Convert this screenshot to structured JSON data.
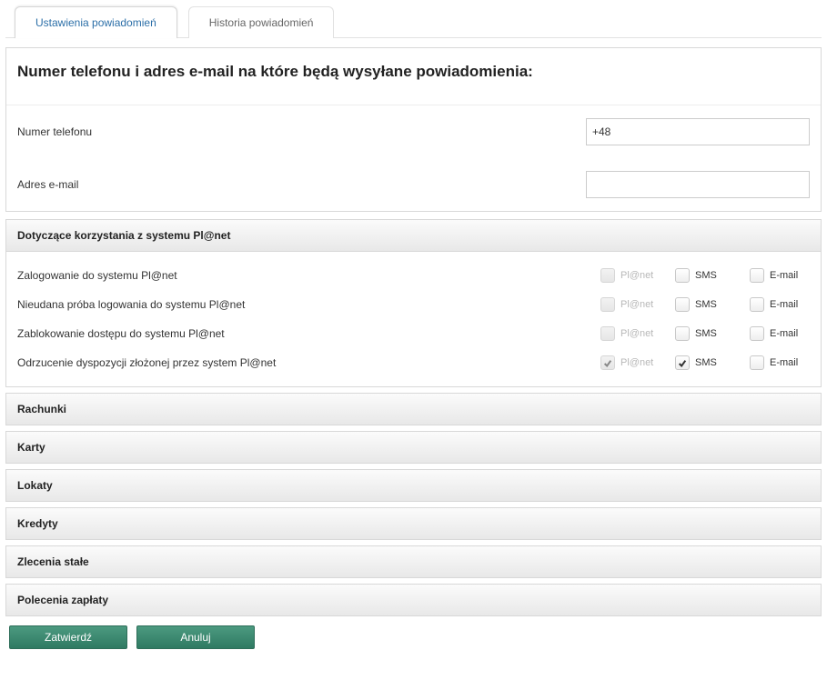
{
  "tabs": {
    "settings": "Ustawienia powiadomień",
    "history": "Historia powiadomień"
  },
  "contact": {
    "title": "Numer telefonu i adres e-mail na które będą wysyłane powiadomienia:",
    "phone_label": "Numer telefonu",
    "phone_value": "+48",
    "email_label": "Adres e-mail",
    "email_value": ""
  },
  "channels": {
    "planet": "Pl@net",
    "sms": "SMS",
    "email": "E-mail"
  },
  "system_section_title": "Dotyczące korzystania z systemu Pl@net",
  "system_rows": [
    {
      "label": "Zalogowanie do systemu Pl@net",
      "planet": {
        "checked": false,
        "enabled": false
      },
      "sms": {
        "checked": false,
        "enabled": true
      },
      "email": {
        "checked": false,
        "enabled": true
      }
    },
    {
      "label": "Nieudana próba logowania do systemu Pl@net",
      "planet": {
        "checked": false,
        "enabled": false
      },
      "sms": {
        "checked": false,
        "enabled": true
      },
      "email": {
        "checked": false,
        "enabled": true
      }
    },
    {
      "label": "Zablokowanie dostępu do systemu Pl@net",
      "planet": {
        "checked": false,
        "enabled": false
      },
      "sms": {
        "checked": false,
        "enabled": true
      },
      "email": {
        "checked": false,
        "enabled": true
      }
    },
    {
      "label": "Odrzucenie dyspozycji złożonej przez system Pl@net",
      "planet": {
        "checked": true,
        "enabled": false
      },
      "sms": {
        "checked": true,
        "enabled": true
      },
      "email": {
        "checked": false,
        "enabled": true
      }
    }
  ],
  "collapsed_sections": [
    "Rachunki",
    "Karty",
    "Lokaty",
    "Kredyty",
    "Zlecenia stałe",
    "Polecenia zapłaty"
  ],
  "buttons": {
    "confirm": "Zatwierdź",
    "cancel": "Anuluj"
  }
}
